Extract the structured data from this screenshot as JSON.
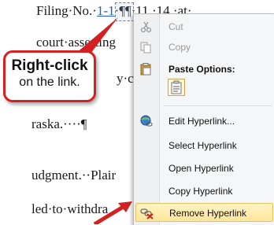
{
  "document": {
    "line1_prefix": "Filing·No.·",
    "line1_link": "1-1",
    "line1_suffix": "·¶¶·11,·14,·at·",
    "line2": "court·asserting",
    "line3_tail": "y·c",
    "line4": "raska.····¶",
    "line5": "udgment.··Plair",
    "line6": "led·to·withdra"
  },
  "callout": {
    "title": "Right-click",
    "text": "on the link."
  },
  "context_menu": {
    "items": [
      {
        "label": "Cut",
        "icon": "scissors-icon",
        "enabled": false
      },
      {
        "label": "Copy",
        "icon": "copy-icon",
        "enabled": false
      },
      {
        "label": "Paste Options:",
        "icon": "clipboard-icon",
        "enabled": true,
        "bold": true
      },
      {
        "label": "Edit Hyperlink...",
        "icon": "globe-link-icon",
        "enabled": true
      },
      {
        "label": "Select Hyperlink",
        "icon": "",
        "enabled": true
      },
      {
        "label": "Open Hyperlink",
        "icon": "",
        "enabled": true
      },
      {
        "label": "Copy Hyperlink",
        "icon": "",
        "enabled": true
      },
      {
        "label": "Remove Hyperlink",
        "icon": "remove-link-icon",
        "enabled": true,
        "highlighted": true
      }
    ]
  },
  "colors": {
    "callout_border": "#d32020",
    "highlight": "#ffe59a",
    "link": "#1f5fbf"
  }
}
